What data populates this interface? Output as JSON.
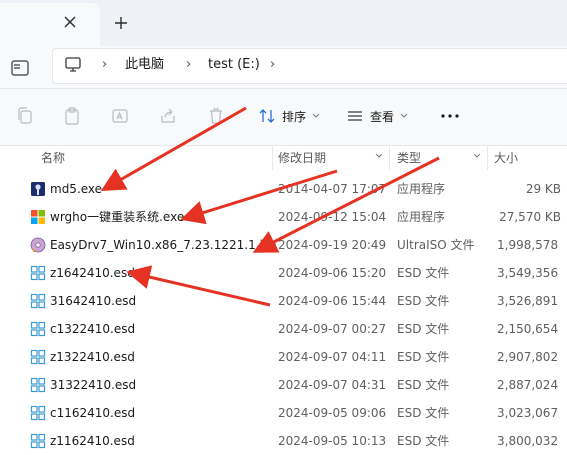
{
  "window": {
    "new_tab_label": "+"
  },
  "address": {
    "separator": "›",
    "crumbs": [
      "此电脑",
      "test (E:)"
    ]
  },
  "toolbar": {
    "sort_label": "排序",
    "view_label": "查看",
    "more_label": "..."
  },
  "columns": {
    "name": "名称",
    "date": "修改日期",
    "type": "类型",
    "size": "大小"
  },
  "files": [
    {
      "name": "md5.exe",
      "date": "2014-04-07 17:07",
      "type": "应用程序",
      "size": "29 KB",
      "icon": "md5-app-icon"
    },
    {
      "name": "wrgho一键重装系统.exe",
      "date": "2024-09-12 15:04",
      "type": "应用程序",
      "size": "27,570 KB",
      "icon": "wrgho-app-icon"
    },
    {
      "name": "EasyDrv7_Win10.x86_7.23.1221.1.iso",
      "date": "2024-09-19 20:49",
      "type": "UltraISO 文件",
      "size": "1,998,578",
      "icon": "ultraiso-icon"
    },
    {
      "name": "z1642410.esd",
      "date": "2024-09-06 15:20",
      "type": "ESD 文件",
      "size": "3,549,356",
      "icon": "esd-file-icon"
    },
    {
      "name": "31642410.esd",
      "date": "2024-09-06 15:44",
      "type": "ESD 文件",
      "size": "3,526,891",
      "icon": "esd-file-icon"
    },
    {
      "name": "c1322410.esd",
      "date": "2024-09-07 00:27",
      "type": "ESD 文件",
      "size": "2,150,654",
      "icon": "esd-file-icon"
    },
    {
      "name": "z1322410.esd",
      "date": "2024-09-07 04:11",
      "type": "ESD 文件",
      "size": "2,907,802",
      "icon": "esd-file-icon"
    },
    {
      "name": "31322410.esd",
      "date": "2024-09-07 04:31",
      "type": "ESD 文件",
      "size": "2,887,024",
      "icon": "esd-file-icon"
    },
    {
      "name": "c1162410.esd",
      "date": "2024-09-05 09:06",
      "type": "ESD 文件",
      "size": "3,023,067",
      "icon": "esd-file-icon"
    },
    {
      "name": "z1162410.esd",
      "date": "2024-09-05 10:13",
      "type": "ESD 文件",
      "size": "3,800,032",
      "icon": "esd-file-icon"
    }
  ],
  "colors": {
    "accent": "#2b6cd4",
    "annotation_arrow": "#e53222",
    "esd_icon": "#3a9bd5"
  }
}
